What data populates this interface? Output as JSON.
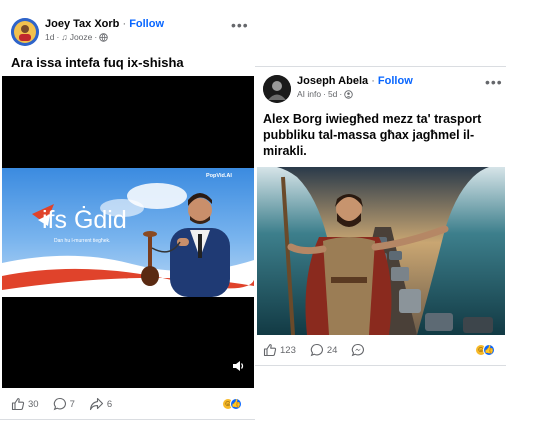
{
  "post_left": {
    "author": "Joey Tax Xorb",
    "follow_label": "Follow",
    "time": "1d",
    "audio": "Jooze",
    "caption": "Ara issa intefa fuq ix-shisha",
    "video": {
      "brand": "ifs Ġdid",
      "tagline": "Dan hu l-murrent tiegħek.",
      "watermark": "PopVid.AI",
      "volume_icon": "speaker-icon"
    },
    "likes": "30",
    "comments": "7",
    "shares": "6"
  },
  "post_right": {
    "author": "Joseph Abela",
    "follow_label": "Follow",
    "ai_label": "AI info",
    "time": "5d",
    "caption": "Alex Borg iwiegħed mezz ta' trasport pubbliku tal-massa għax jagħmel il-mirakli.",
    "likes": "123",
    "comments": "24"
  },
  "colors": {
    "facebook_blue": "#0866ff",
    "meta_gray": "#65676b",
    "laugh_yellow": "#f7b928"
  }
}
